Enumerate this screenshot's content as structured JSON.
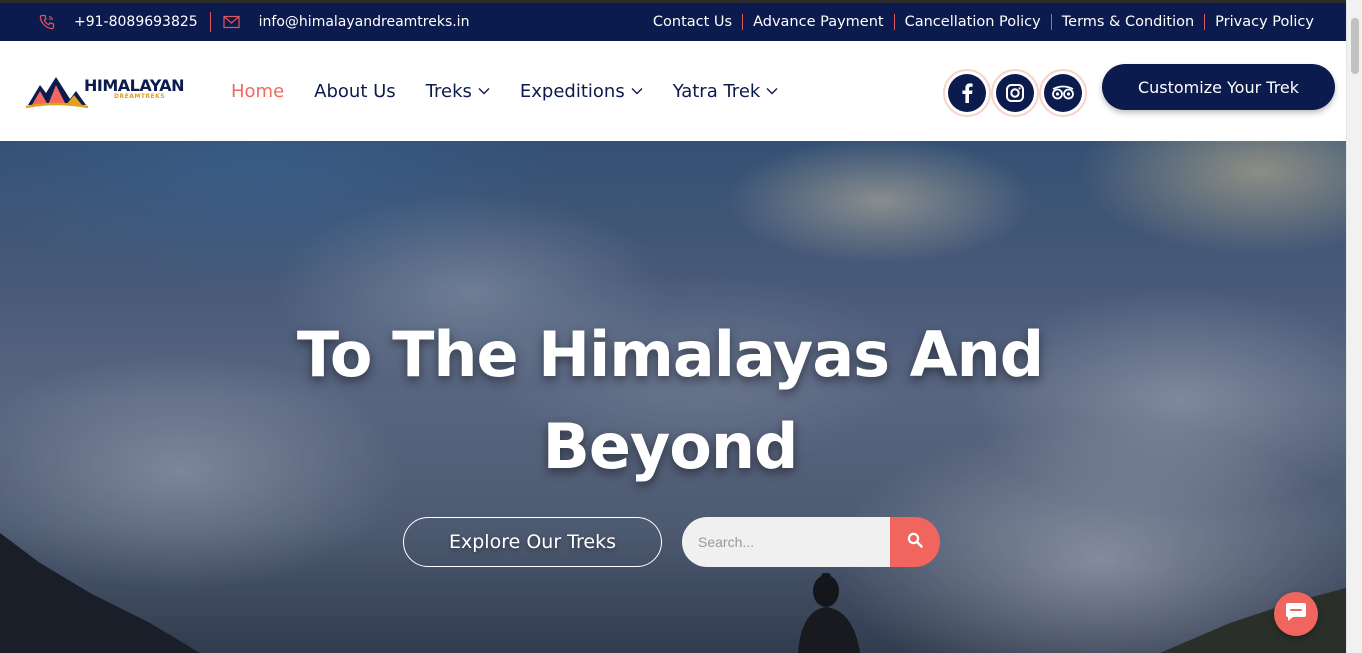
{
  "topbar": {
    "phone": "+91-8089693825",
    "email": "info@himalayandreamtreks.in",
    "links": [
      "Contact Us",
      "Advance Payment",
      "Cancellation Policy",
      "Terms & Condition",
      "Privacy Policy"
    ]
  },
  "brand": {
    "name": "HIMALAYAN",
    "sub": "DREAMTREKS"
  },
  "nav": {
    "items": [
      {
        "label": "Home",
        "active": true
      },
      {
        "label": "About Us"
      },
      {
        "label": "Treks",
        "dropdown": true
      },
      {
        "label": "Expeditions",
        "dropdown": true
      },
      {
        "label": "Yatra Trek",
        "dropdown": true
      }
    ]
  },
  "socials": [
    "facebook-icon",
    "instagram-icon",
    "tripadvisor-icon"
  ],
  "cta": {
    "label": "Customize Your Trek"
  },
  "hero": {
    "title_line1": "To The Himalayas And",
    "title_line2": "Beyond",
    "explore_label": "Explore Our Treks",
    "search_placeholder": "Search..."
  },
  "colors": {
    "navy": "#0c1b4d",
    "accent": "#f0685e"
  }
}
